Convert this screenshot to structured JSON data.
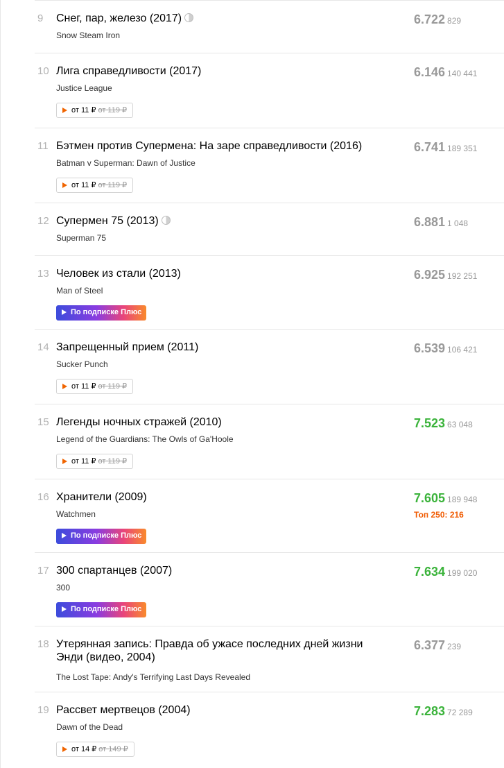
{
  "items": [
    {
      "num": "9",
      "title": "Снег, пар, железо (2017)",
      "original": "Snow Steam Iron",
      "rating": "6.722",
      "votes": "829",
      "green": false,
      "badge3d": true
    },
    {
      "num": "10",
      "title": "Лига справедливости (2017)",
      "original": "Justice League",
      "rating": "6.146",
      "votes": "140 441",
      "green": false,
      "buy": {
        "price": "от 11 ₽",
        "old": "от 119 ₽"
      }
    },
    {
      "num": "11",
      "title": "Бэтмен против Супермена: На заре справедливости (2016)",
      "original": "Batman v Superman: Dawn of Justice",
      "rating": "6.741",
      "votes": "189 351",
      "green": false,
      "buy": {
        "price": "от 11 ₽",
        "old": "от 119 ₽"
      }
    },
    {
      "num": "12",
      "title": "Супермен 75 (2013)",
      "original": "Superman 75",
      "rating": "6.881",
      "votes": "1 048",
      "green": false,
      "badge3d": true
    },
    {
      "num": "13",
      "title": "Человек из стали (2013)",
      "original": "Man of Steel",
      "rating": "6.925",
      "votes": "192 251",
      "green": false,
      "plus": "По подписке Плюс"
    },
    {
      "num": "14",
      "title": "Запрещенный прием (2011)",
      "original": "Sucker Punch",
      "rating": "6.539",
      "votes": "106 421",
      "green": false,
      "buy": {
        "price": "от 11 ₽",
        "old": "от 119 ₽"
      }
    },
    {
      "num": "15",
      "title": "Легенды ночных стражей (2010)",
      "original": "Legend of the Guardians: The Owls of Ga'Hoole",
      "rating": "7.523",
      "votes": "63 048",
      "green": true,
      "buy": {
        "price": "от 11 ₽",
        "old": "от 119 ₽"
      }
    },
    {
      "num": "16",
      "title": "Хранители (2009)",
      "original": "Watchmen",
      "rating": "7.605",
      "votes": "189 948",
      "green": true,
      "top250": "Топ 250: 216",
      "plus": "По подписке Плюс"
    },
    {
      "num": "17",
      "title": "300 спартанцев (2007)",
      "original": "300",
      "rating": "7.634",
      "votes": "199 020",
      "green": true,
      "plus": "По подписке Плюс"
    },
    {
      "num": "18",
      "title": "Утерянная запись: Правда об ужасе последних дней жизни Энди (видео, 2004)",
      "original": "The Lost Tape: Andy's Terrifying Last Days Revealed",
      "rating": "6.377",
      "votes": "239",
      "green": false
    },
    {
      "num": "19",
      "title": "Рассвет мертвецов (2004)",
      "original": "Dawn of the Dead",
      "rating": "7.283",
      "votes": "72 289",
      "green": true,
      "buy": {
        "price": "от 14 ₽",
        "old": "от 149 ₽"
      }
    }
  ]
}
